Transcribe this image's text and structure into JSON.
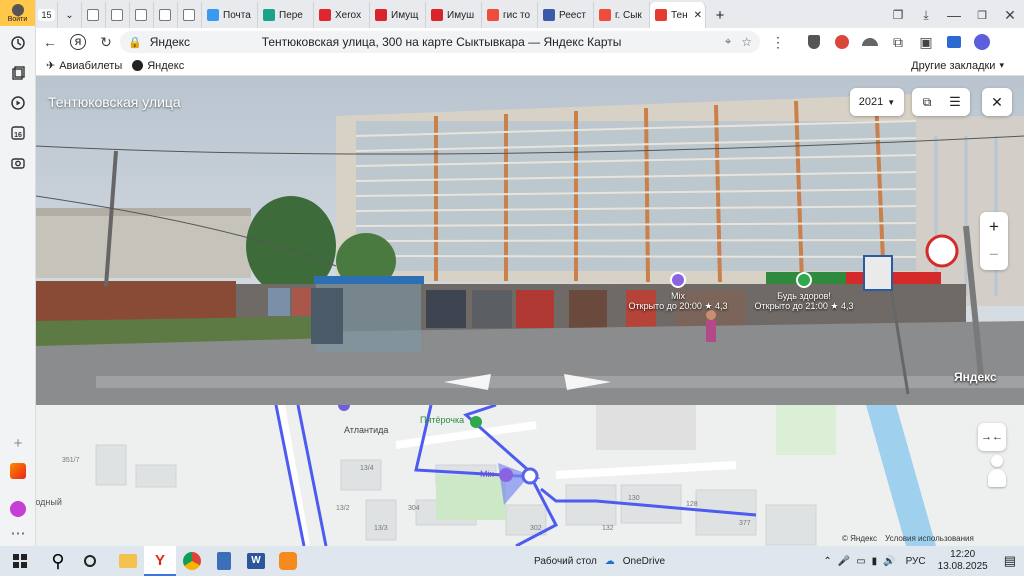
{
  "profile": {
    "label": "Войти"
  },
  "tabs": {
    "counter": "15",
    "items": [
      {
        "label": "",
        "icon": "doc-icon",
        "color": "#ffffff"
      },
      {
        "label": "",
        "icon": "doc-icon",
        "color": "#ffffff"
      },
      {
        "label": "",
        "icon": "doc-icon",
        "color": "#ffffff"
      },
      {
        "label": "",
        "icon": "doc-icon",
        "color": "#ffffff"
      },
      {
        "label": "",
        "icon": "doc-icon",
        "color": "#ffffff"
      },
      {
        "label": "Почта",
        "icon": "mail-icon",
        "color": "#3a9af0"
      },
      {
        "label": "Пере",
        "icon": "messenger-icon",
        "color": "#1aa389"
      },
      {
        "label": "Xerox",
        "icon": "rbc-icon",
        "color": "#e0262f"
      },
      {
        "label": "Имущ",
        "icon": "rtc-icon",
        "color": "#d8242a"
      },
      {
        "label": "Имуш",
        "icon": "rtc-icon",
        "color": "#d8242a"
      },
      {
        "label": "гис то",
        "icon": "yandex-icon",
        "color": "#f04c3c"
      },
      {
        "label": "Реест",
        "icon": "emblem-icon",
        "color": "#3d5aa8"
      },
      {
        "label": "г. Сык",
        "icon": "yandex-icon",
        "color": "#f04c3c"
      },
      {
        "label": "Тен",
        "icon": "maps-pin-icon",
        "color": "#e53b30"
      }
    ],
    "new_tab": "+"
  },
  "addressbar": {
    "site": "Яндекс",
    "title": "Тентюковская улица, 300 на карте Сыктывкара — Яндекс Карты"
  },
  "bookmarks": {
    "items": [
      "Авиабилеты",
      "Яндекс"
    ],
    "other": "Другие закладки"
  },
  "panorama": {
    "street_name": "Тентюковская улица",
    "year": "2021",
    "watermark": "Яндекс",
    "pois": [
      {
        "name": "Mix",
        "status": "Открыто до 20:00",
        "rating": "★ 4,3"
      },
      {
        "name": "Будь здоров!",
        "status": "Открыто до 21:00",
        "rating": "★ 4,3"
      }
    ],
    "zoom_in": "+",
    "zoom_out": "−"
  },
  "map": {
    "labels": [
      "Атлантида",
      "Пятёрочка",
      "Mix",
      "Свободный"
    ],
    "house_numbers": [
      "351/7",
      "13/4",
      "13/3",
      "13/2",
      "304",
      "302",
      "130",
      "132",
      "377",
      "128"
    ],
    "copyright": "© Яндекс",
    "terms": "Условия использования"
  },
  "taskbar": {
    "desktop_label": "Рабочий стол",
    "onedrive": "OneDrive",
    "lang": "РУС",
    "time": "12:20",
    "date": "13.08.2025"
  },
  "colors": {
    "accent": "#7b4fe0",
    "yandex_red": "#fc3f1d",
    "route_blue": "#4d5bf0"
  }
}
